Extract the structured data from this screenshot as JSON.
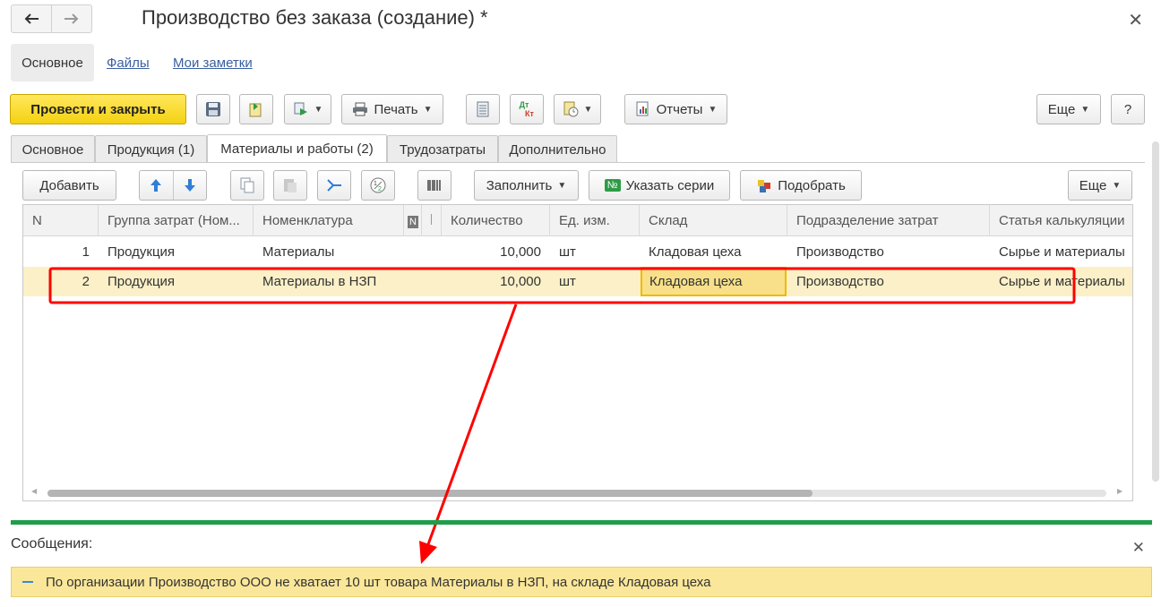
{
  "window": {
    "title": "Производство без заказа (создание) *"
  },
  "sections": {
    "active": "Основное",
    "files": "Файлы",
    "notes": "Мои заметки"
  },
  "toolbar": {
    "post_close": "Провести и закрыть",
    "print": "Печать",
    "reports": "Отчеты",
    "more": "Еще",
    "help": "?",
    "dtkt_top": "Дт",
    "dtkt_bottom": "Кт"
  },
  "tabs": [
    "Основное",
    "Продукция (1)",
    "Материалы и работы (2)",
    "Трудозатраты",
    "Дополнительно"
  ],
  "table_toolbar": {
    "add": "Добавить",
    "fill": "Заполнить",
    "series": "Указать серии",
    "pick": "Подобрать",
    "more": "Еще"
  },
  "table": {
    "columns": [
      "N",
      "Группа затрат (Ном...",
      "Номенклатура",
      "N",
      "Количество",
      "Ед. изм.",
      "Склад",
      "Подразделение затрат",
      "Статья калькуляции"
    ],
    "rows": [
      {
        "n": "1",
        "group": "Продукция",
        "item": "Материалы",
        "qty": "10,000",
        "unit": "шт",
        "warehouse": "Кладовая цеха",
        "dept": "Производство",
        "article": "Сырье и материалы"
      },
      {
        "n": "2",
        "group": "Продукция",
        "item": "Материалы в НЗП",
        "qty": "10,000",
        "unit": "шт",
        "warehouse": "Кладовая цеха",
        "dept": "Производство",
        "article": "Сырье и материалы"
      }
    ]
  },
  "messages": {
    "title": "Сообщения:",
    "items": [
      "По организации Производство ООО не хватает 10 шт товара Материалы в НЗП, на складе Кладовая цеха"
    ]
  },
  "colors": {
    "primary": "#f4d112",
    "highlight": "#ff0000",
    "green": "#1f9e4a",
    "message": "#fbe79a"
  }
}
